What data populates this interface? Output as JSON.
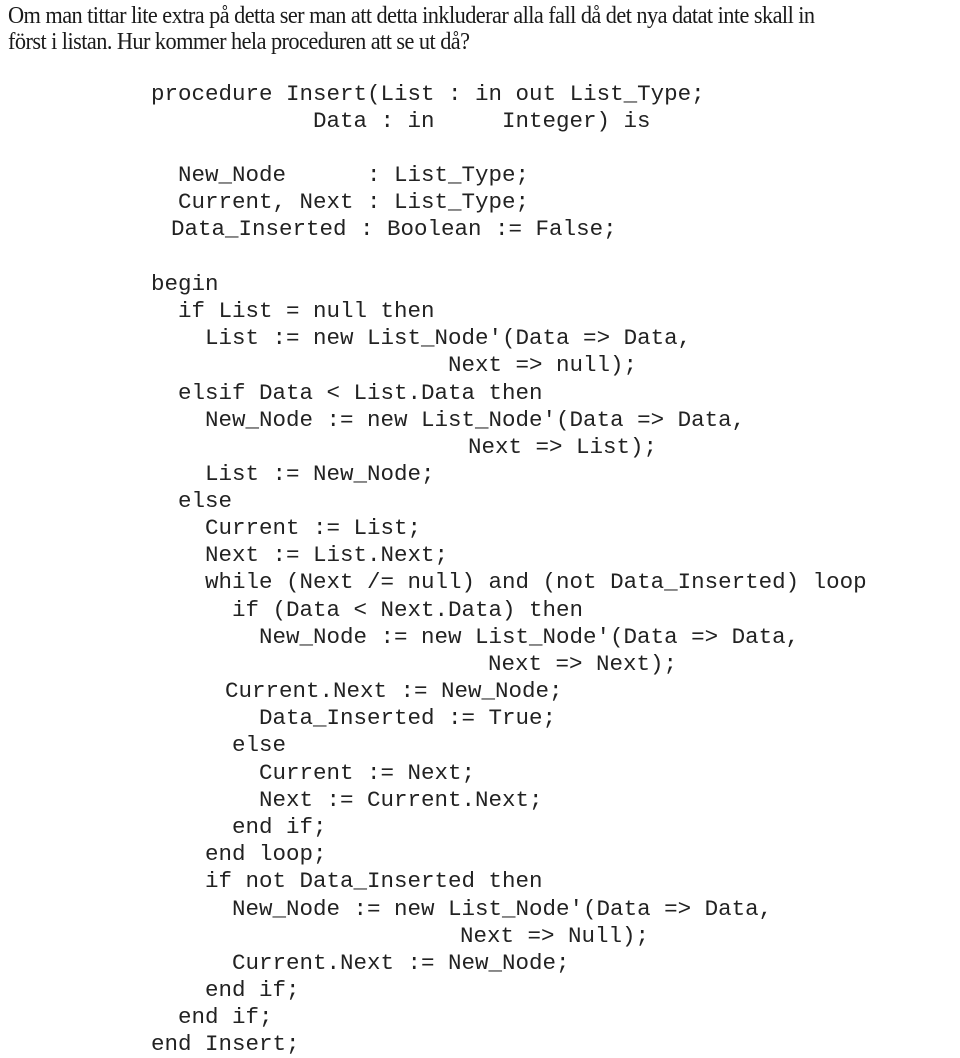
{
  "intro": {
    "line1": "Om man tittar lite extra på detta ser man att detta inkluderar alla fall då det nya datat inte skall in",
    "line2": "först i listan. Hur kommer hela proceduren att se ut då?"
  },
  "code": {
    "lines": [
      "procedure Insert(List : in out List_Type;",
      "Data : in     Integer) is",
      "New_Node      : List_Type;",
      "Current, Next : List_Type;",
      "Data_Inserted : Boolean := False;",
      "begin",
      "if List = null then",
      "List := new List_Node'(Data => Data,",
      "Next => null);",
      "elsif Data < List.Data then",
      "New_Node := new List_Node'(Data => Data,",
      "Next => List);",
      "List := New_Node;",
      "else",
      "Current := List;",
      "Next := List.Next;",
      "while (Next /= null) and (not Data_Inserted) loop",
      "if (Data < Next.Data) then",
      "New_Node := new List_Node'(Data => Data,",
      "Next => Next);",
      "Current.Next := New_Node;",
      "Data_Inserted := True;",
      "else",
      "Current := Next;",
      "Next := Current.Next;",
      "end if;",
      "end loop;",
      "if not Data_Inserted then",
      "New_Node := new List_Node'(Data => Data,",
      "Next => Null);",
      "Current.Next := New_Node;",
      "end if;",
      "end if;",
      "end Insert;"
    ]
  }
}
